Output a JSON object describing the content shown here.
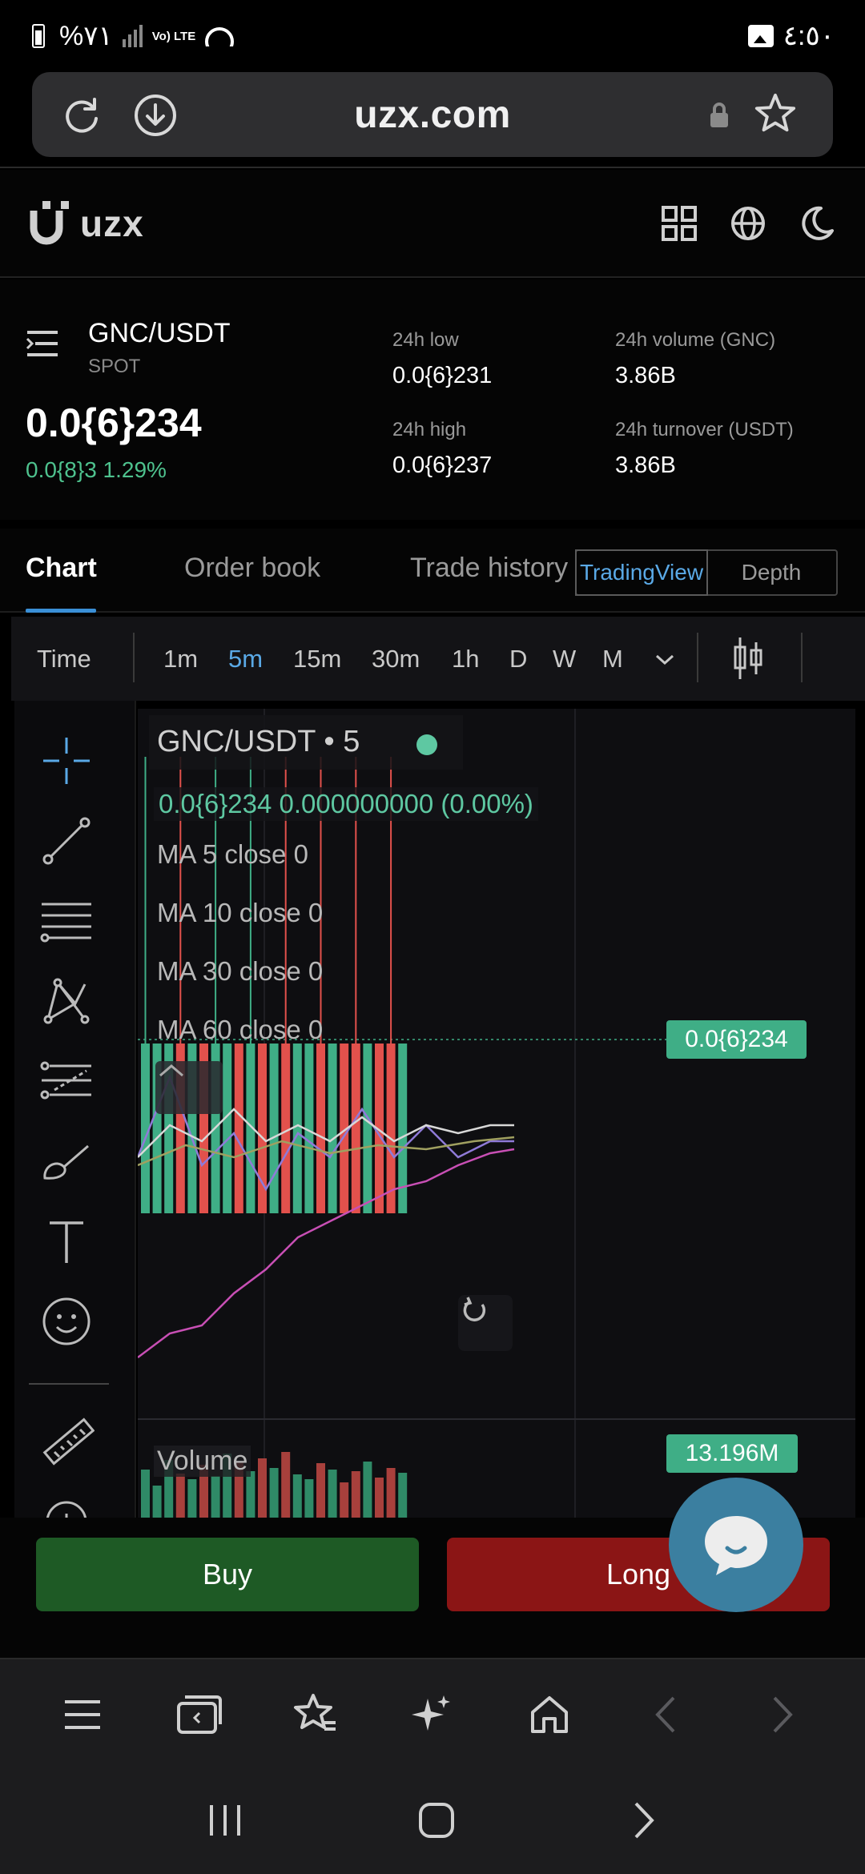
{
  "status_bar": {
    "battery": "%٧١",
    "lte": "Vo) LTE",
    "time": "٤:٥٠"
  },
  "browser": {
    "url": "uzx.com"
  },
  "site": {
    "logo_text": "uzx"
  },
  "market": {
    "pair": "GNC/USDT",
    "type": "SPOT",
    "price": "0.0{6}234",
    "change": "0.0{8}3 1.29%",
    "stats": [
      {
        "label": "24h low",
        "value": "0.0{6}231"
      },
      {
        "label": "24h volume (GNC)",
        "value": "3.86B"
      },
      {
        "label": "24h high",
        "value": "0.0{6}237"
      },
      {
        "label": "24h turnover (USDT)",
        "value": "3.86B"
      }
    ]
  },
  "tabs": {
    "chart": "Chart",
    "order_book": "Order book",
    "trade_history": "Trade history",
    "tradingview": "TradingView",
    "depth": "Depth"
  },
  "toolbar": {
    "time": "Time",
    "intervals": [
      "1m",
      "5m",
      "15m",
      "30m",
      "1h",
      "D",
      "W",
      "M"
    ],
    "active_interval": "5m",
    "active_color": "#5aa9e6"
  },
  "chart": {
    "symbol": "GNC/USDT",
    "interval_label": "• 5",
    "ohlc_line": "0.0{6}234  0.000000000 (0.00%)",
    "ma": [
      "MA 5 close 0",
      "MA 10 close 0",
      "MA 30 close 0",
      "MA 60 close 0"
    ],
    "price_tag": "0.0{6}234",
    "volume_label": "Volume",
    "volume_tag": "13.196M",
    "up_color": "#3fae86",
    "down_color": "#e2514c"
  },
  "actions": {
    "buy": "Buy",
    "long": "Long"
  }
}
